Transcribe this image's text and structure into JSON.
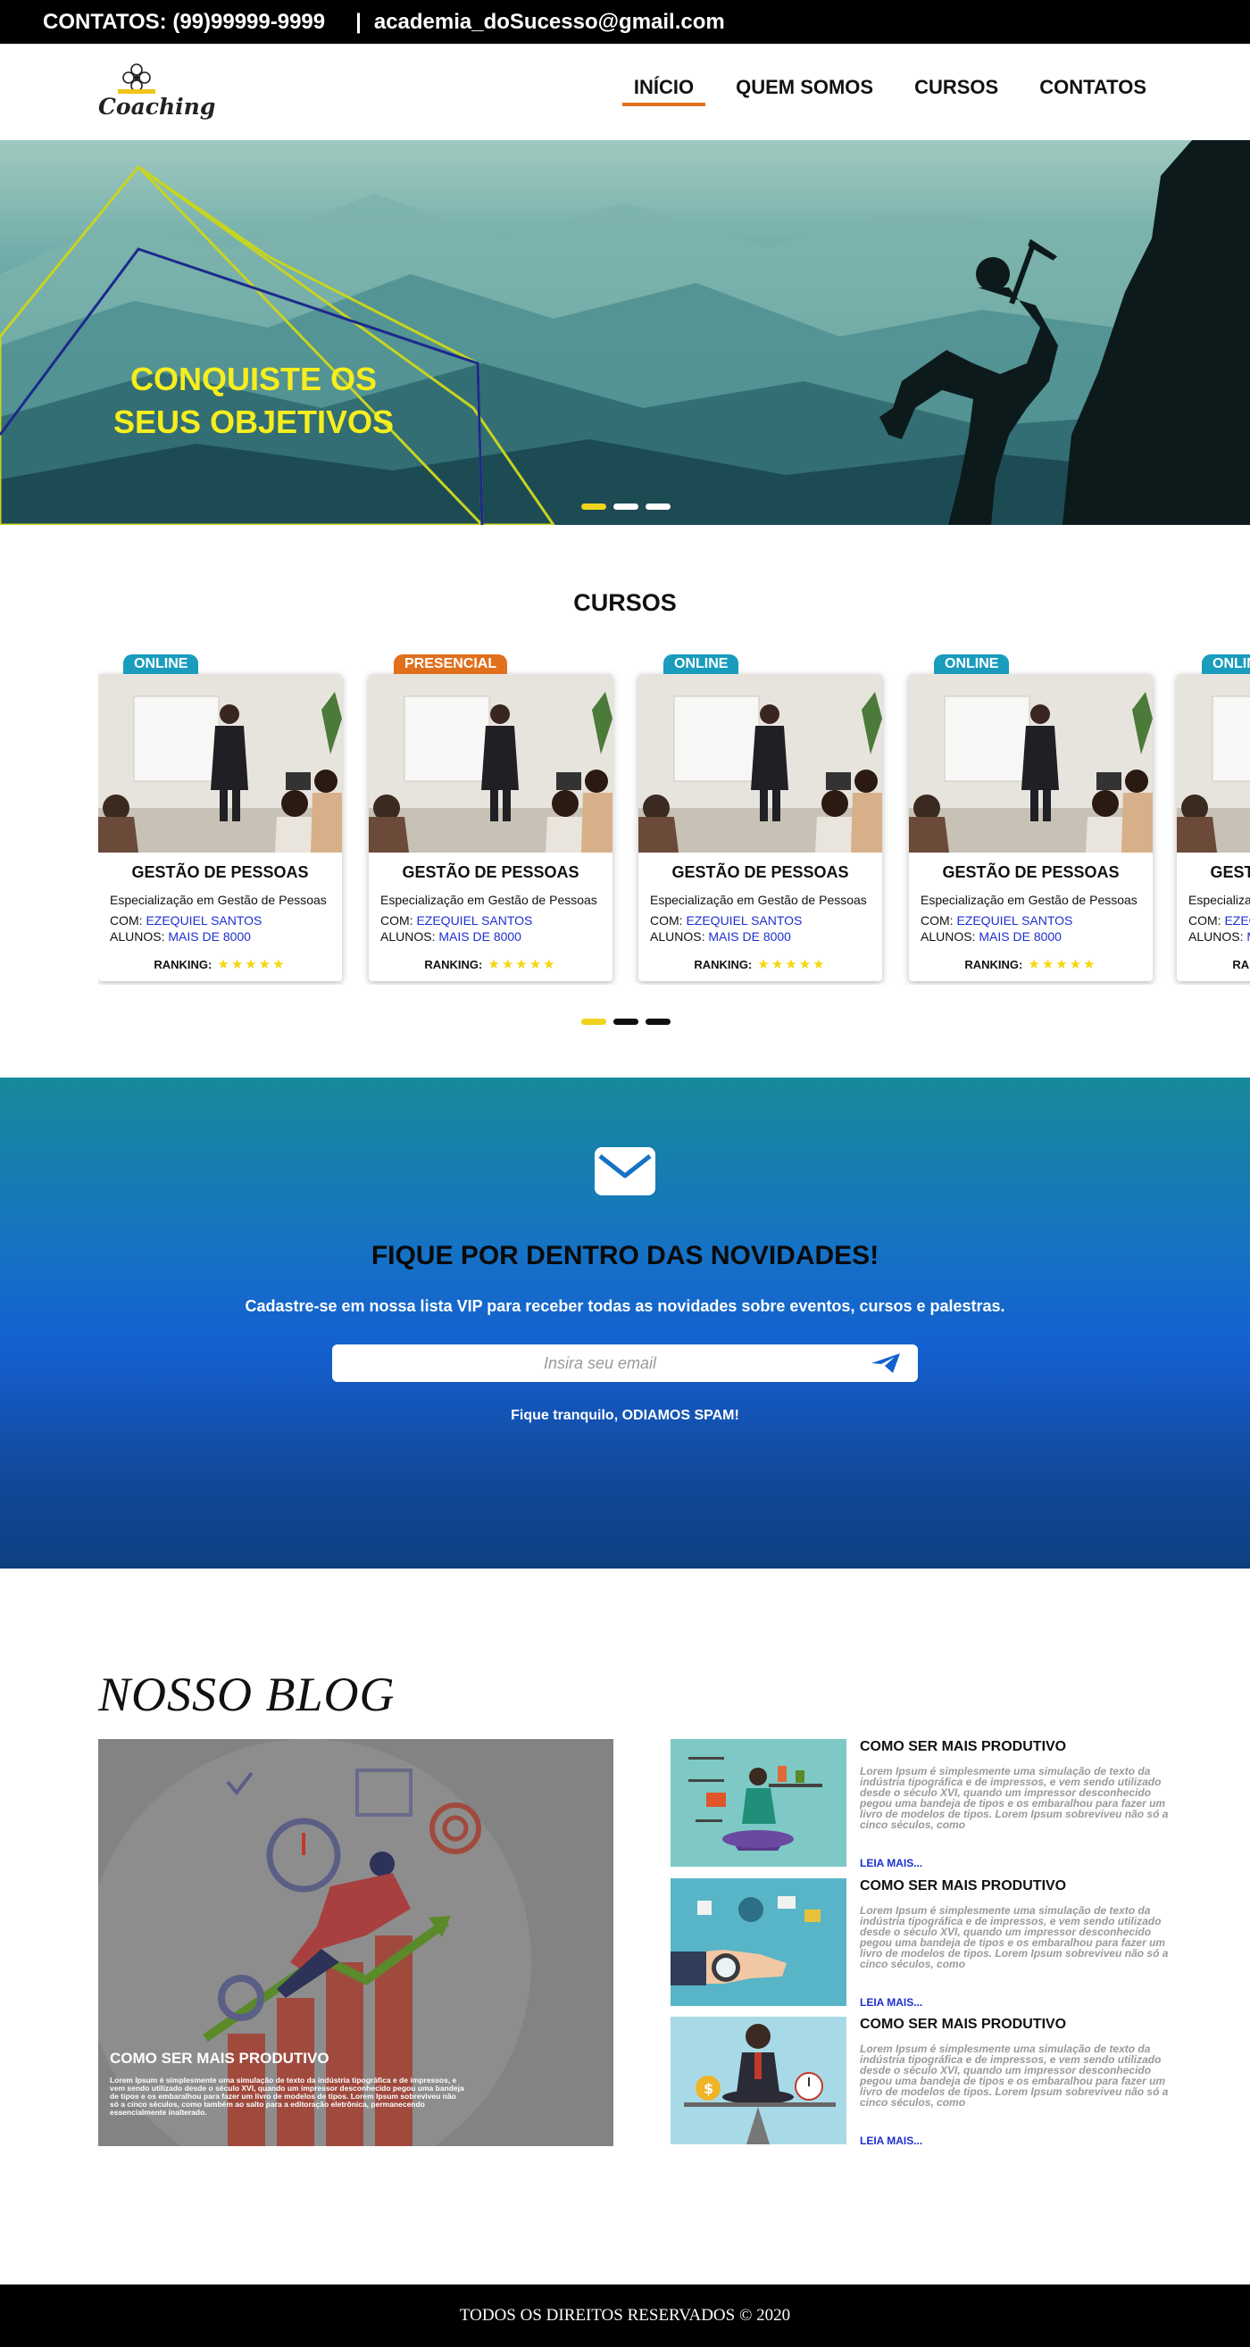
{
  "topbar": {
    "contacts": "CONTATOS: (99)99999-9999",
    "separator": "|",
    "email": "academia_doSucesso@gmail.com"
  },
  "logo": {
    "word": "Coaching"
  },
  "nav": {
    "items": [
      {
        "label": "INÍCIO",
        "active": true
      },
      {
        "label": "QUEM SOMOS",
        "active": false
      },
      {
        "label": "CURSOS",
        "active": false
      },
      {
        "label": "CONTATOS",
        "active": false
      }
    ],
    "accent": "#e0701c"
  },
  "hero": {
    "title": "CONQUISTE OS SEUS OBJETIVOS",
    "title_color": "#f6ee1e",
    "slides": 3,
    "active_slide": 1
  },
  "courses": {
    "title": "CURSOS",
    "cards": [
      {
        "badge": "ONLINE",
        "name": "GESTÃO DE PESSOAS",
        "spec": "Especialização em Gestão de Pessoas",
        "com_label": "COM:",
        "teacher": "EZEQUIEL SANTOS",
        "students_label": "ALUNOS:",
        "students": "MAIS DE 8000",
        "ranking_label": "RANKING:",
        "stars": "★★★★★"
      },
      {
        "badge": "PRESENCIAL",
        "name": "GESTÃO DE PESSOAS",
        "spec": "Especialização em Gestão de Pessoas",
        "com_label": "COM:",
        "teacher": "EZEQUIEL SANTOS",
        "students_label": "ALUNOS:",
        "students": "MAIS DE 8000",
        "ranking_label": "RANKING:",
        "stars": "★★★★★"
      },
      {
        "badge": "ONLINE",
        "name": "GESTÃO DE PESSOAS",
        "spec": "Especialização em Gestão de Pessoas",
        "com_label": "COM:",
        "teacher": "EZEQUIEL SANTOS",
        "students_label": "ALUNOS:",
        "students": "MAIS DE 8000",
        "ranking_label": "RANKING:",
        "stars": "★★★★★"
      },
      {
        "badge": "ONLINE",
        "name": "GESTÃO DE PESSOAS",
        "spec": "Especialização em Gestão de Pessoas",
        "com_label": "COM:",
        "teacher": "EZEQUIEL SANTOS",
        "students_label": "ALUNOS:",
        "students": "MAIS DE 8000",
        "ranking_label": "RANKING:",
        "stars": "★★★★★"
      },
      {
        "badge": "ONLINE",
        "name": "GESTÃO DE PESSOAS",
        "spec": "Especialização em Gestão de Pessoas",
        "com_label": "COM:",
        "teacher": "EZEQUIEL SANTOS",
        "students_label": "ALUNOS:",
        "students": "MAIS DE 8000",
        "ranking_label": "RANKING:",
        "stars": "★★★★★"
      }
    ],
    "badge_colors": {
      "ONLINE": "#1a9cbd",
      "PRESENCIAL": "#e0701c"
    },
    "pages": 3,
    "active_page": 1
  },
  "newsletter": {
    "icon": "envelope-icon",
    "title": "FIQUE POR DENTRO DAS NOVIDADES!",
    "subtitle": "Cadastre-se em nossa lista VIP para receber todas as novidades sobre eventos, cursos e palestras.",
    "placeholder": "Insira seu email",
    "send_icon": "paper-plane-icon",
    "note": "Fique tranquilo, ODIAMOS SPAM!"
  },
  "blog": {
    "title": "NOSSO BLOG",
    "featured": {
      "title": "COMO SER MAIS PRODUTIVO",
      "text": "Lorem Ipsum é simplesmente uma simulação de texto da indústria tipográfica e de impressos, e vem sendo utilizado desde o século XVI, quando um impressor desconhecido pegou uma bandeja de tipos e os embaralhou para fazer um livro de modelos de tipos. Lorem Ipsum sobreviveu não só a cinco séculos, como também ao salto para a editoração eletrônica, permanecendo essencialmente inalterado."
    },
    "posts": [
      {
        "title": "COMO SER MAIS PRODUTIVO",
        "text": "Lorem Ipsum é simplesmente uma simulação de texto da indústria tipográfica e de impressos, e vem sendo utilizado desde o século XVI, quando um impressor desconhecido pegou uma bandeja de tipos e os embaralhou para fazer um livro de modelos de tipos. Lorem Ipsum sobreviveu não só a cinco séculos, como",
        "link": "LEIA MAIS..."
      },
      {
        "title": "COMO SER MAIS PRODUTIVO",
        "text": "Lorem Ipsum é simplesmente uma simulação de texto da indústria tipográfica e de impressos, e vem sendo utilizado desde o século XVI, quando um impressor desconhecido pegou uma bandeja de tipos e os embaralhou para fazer um livro de modelos de tipos. Lorem Ipsum sobreviveu não só a cinco séculos, como",
        "link": "LEIA MAIS..."
      },
      {
        "title": "COMO SER MAIS PRODUTIVO",
        "text": "Lorem Ipsum é simplesmente uma simulação de texto da indústria tipográfica e de impressos, e vem sendo utilizado desde o século XVI, quando um impressor desconhecido pegou uma bandeja de tipos e os embaralhou para fazer um livro de modelos de tipos. Lorem Ipsum sobreviveu não só a cinco séculos, como",
        "link": "LEIA MAIS..."
      }
    ]
  },
  "footer": {
    "text": "TODOS OS DIREITOS RESERVADOS © 2020"
  }
}
